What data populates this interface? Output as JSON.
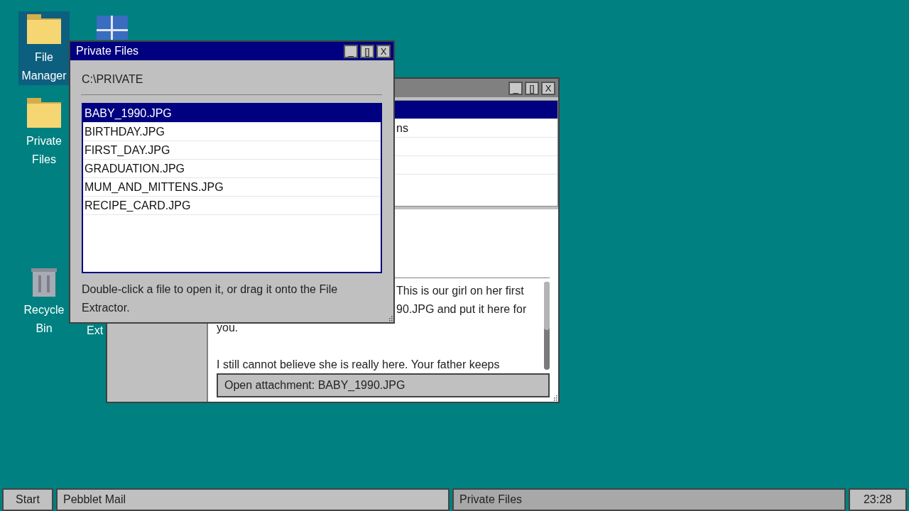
{
  "desktop_icons": [
    {
      "label": "File Manager",
      "kind": "folder",
      "selected": true
    },
    {
      "label": "Private Files",
      "kind": "folder",
      "selected": false
    },
    {
      "label": "Recycle Bin",
      "kind": "trash",
      "selected": false
    },
    {
      "kind": "app",
      "selected": false
    },
    {
      "label": "Ext",
      "kind": "covered",
      "selected": false
    }
  ],
  "mail_window": {
    "controls": [
      "_",
      "[]",
      "X"
    ],
    "messages": [
      {
        "selected": true
      },
      {
        "visible_text": "ns",
        "selected": false
      },
      {
        "selected": false
      },
      {
        "selected": false
      }
    ],
    "body_paragraphs": [
      {
        "lines": [
          {
            "text": "This is our girl on her first",
            "kind": "partial"
          },
          {
            "text": "90.JPG and put it here for",
            "kind": "partial"
          },
          {
            "text": "you.",
            "kind": "full"
          }
        ]
      },
      {
        "lines": [
          {
            "text": "I still cannot believe she is really here. Your father keeps",
            "kind": "full"
          }
        ]
      }
    ],
    "attachment_button": "Open attachment: BABY_1990.JPG"
  },
  "files_window": {
    "title": "Private Files",
    "controls": [
      "_",
      "[]",
      "X"
    ],
    "path": "C:\\PRIVATE",
    "files": [
      {
        "name": "BABY_1990.JPG",
        "selected": true
      },
      {
        "name": "BIRTHDAY.JPG",
        "selected": false
      },
      {
        "name": "FIRST_DAY.JPG",
        "selected": false
      },
      {
        "name": "GRADUATION.JPG",
        "selected": false
      },
      {
        "name": "MUM_AND_MITTENS.JPG",
        "selected": false
      },
      {
        "name": "RECIPE_CARD.JPG",
        "selected": false
      }
    ],
    "hint": "Double-click a file to open it, or drag it onto the File Extractor."
  },
  "taskbar": {
    "start": "Start",
    "tasks": [
      {
        "label": "Pebblet Mail",
        "selected": false
      },
      {
        "label": "Private Files",
        "selected": true
      }
    ],
    "clock": "23:28"
  }
}
